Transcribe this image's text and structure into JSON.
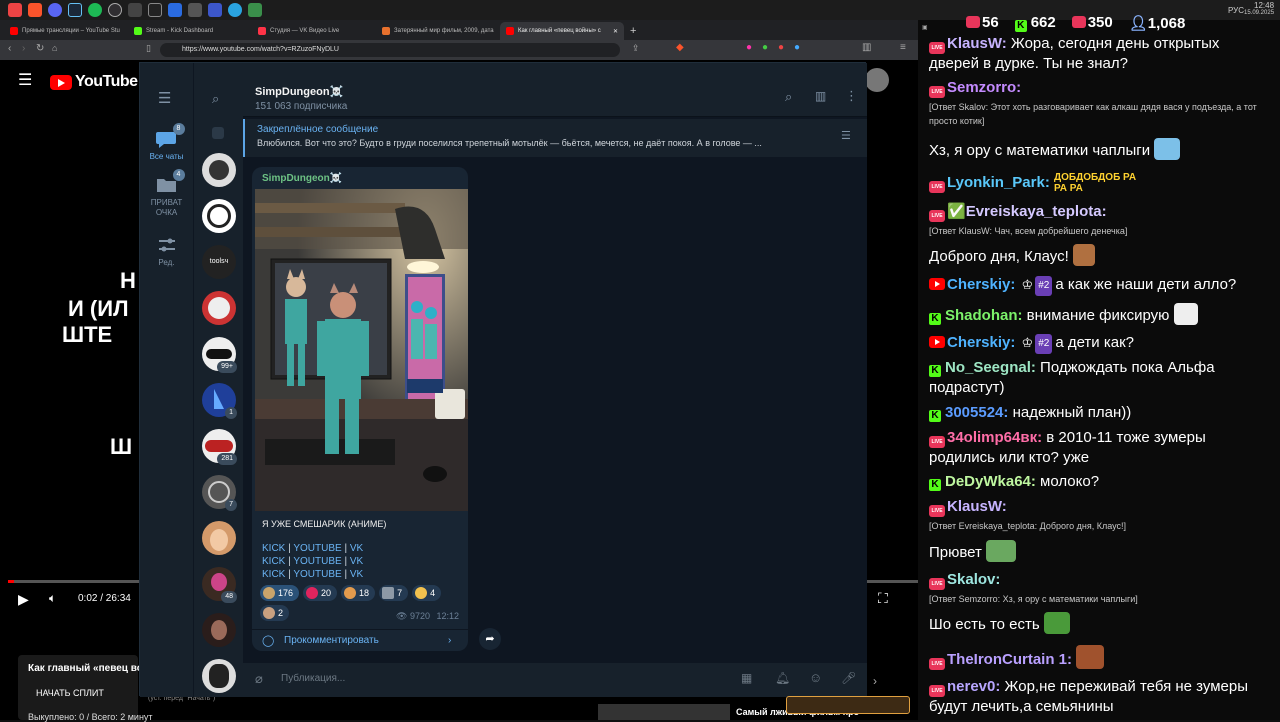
{
  "browser": {
    "tabs": [
      {
        "label": "Прямые трансляции – YouTube Stu",
        "color": "#ff0000"
      },
      {
        "label": "Stream - Kick Dashboard",
        "color": "#53fc18"
      },
      {
        "label": "Студия — VK Видео Live",
        "color": "#ff3347"
      },
      {
        "label": "Затерянный мир фильм, 2009, дата",
        "color": "#e8712d"
      },
      {
        "label": "Как главный «певец войны» с",
        "color": "#ff0000"
      }
    ],
    "url": "https://www.youtube.com/watch?v=RZuzoFNyDLU",
    "new_tab": "+"
  },
  "youtube": {
    "logo": "YouTube",
    "region": "LV",
    "hero_lines": [
      "Н",
      "И (ИЛ",
      "ШТЕ",
      "Ш"
    ],
    "time": "0:02 / 26:34",
    "video_title": "Как главный «певец вой",
    "split_button": "НАЧАТЬ СПЛИТ",
    "bought": "Выкуплено: 0 / Всего: 2 минут",
    "hint": "(уст. перед \"Начать\")",
    "right_title": "Самый лживый фильм про"
  },
  "telegram": {
    "rail": [
      {
        "label": "Все чаты",
        "badge": "8"
      },
      {
        "label": "ПРИВАТ ОЧКА",
        "badge": "4"
      },
      {
        "label": "Ред.",
        "badge": ""
      }
    ],
    "chat_badges": [
      "99+",
      "1",
      "281",
      "7",
      "48"
    ],
    "tools_avatar": "toolsч",
    "channel_name": "SimpDungeon☠️",
    "subscribers": "151 063 подписчика",
    "pinned_title": "Закреплённое сообщение",
    "pinned_text": "Влюбился.   Вот что это? Будто в груди поселился трепетный мотылёк — бьётся, мечется, не даёт покоя. А в голове — ...",
    "post": {
      "author": "SimpDungeon☠️",
      "caption": "Я УЖЕ СМЕШАРИК (АНИМЕ)",
      "links": [
        "KICK",
        "YOUTUBE",
        "VK"
      ],
      "separator": "|",
      "reactions": [
        {
          "count": "176",
          "color": "#c9a46b"
        },
        {
          "count": "20",
          "color": "#e0245e"
        },
        {
          "count": "18",
          "color": "#e39b4d"
        },
        {
          "count": "7",
          "color": "#8d99a6"
        },
        {
          "count": "4",
          "color": "#f2c14e"
        },
        {
          "count": "2",
          "color": "#c8a080"
        }
      ],
      "views": "9720",
      "time": "12:12",
      "comment": "Прокомментировать"
    },
    "composer_placeholder": "Публикация..."
  },
  "chat": {
    "stats": [
      {
        "icon": "vk-live-icon",
        "value": "56"
      },
      {
        "icon": "kick-icon",
        "value": "662"
      },
      {
        "icon": "vk-live-icon",
        "value": "350"
      },
      {
        "icon": "viewer-icon",
        "value": "1,068"
      }
    ],
    "messages": [
      {
        "platform": "live",
        "nick": "KlausW:",
        "color": "#c7b4ff",
        "text": "Жора, сегодня день открытых дверей в дурке. Ты не знал?"
      },
      {
        "platform": "live",
        "nick": "Semzorro:",
        "color": "#c48bff",
        "text": "",
        "reply": "[Ответ Skalov: Этот хоть разговаривает как алкаш дядя вася у подъезда, а тот просто котик]"
      },
      {
        "platform": "none",
        "nick": "",
        "color": "#fff",
        "text": "Хз, я ору с математики чаплыги"
      },
      {
        "platform": "live",
        "nick": "Lyonkin_Park:",
        "color": "#5ac8fa",
        "text": "",
        "emote_text": "ДОБДОБДОБ РА РА РА"
      },
      {
        "platform": "live",
        "nick": "Evreiskaya_teplota:",
        "color": "#d5c9ff",
        "text": "",
        "reply": "[Ответ KlausW: Чач, всем добрейшего денечка]"
      },
      {
        "platform": "none",
        "nick": "",
        "color": "#fff",
        "text": "Доброго дня, Клаус!"
      },
      {
        "platform": "yt",
        "nick": "Cherskiy:",
        "color": "#4fb3ff",
        "text": "а как же наши дети алло?",
        "rank": "#2"
      },
      {
        "platform": "kick",
        "nick": "Shadohan:",
        "color": "#7cf26a",
        "text": "внимание фиксирую"
      },
      {
        "platform": "yt",
        "nick": "Cherskiy:",
        "color": "#4fb3ff",
        "text": "а дети как?",
        "rank": "#2"
      },
      {
        "platform": "kick",
        "nick": "No_Seegnal:",
        "color": "#9ee6c4",
        "text": "Поджождать пока Альфа подрастут)"
      },
      {
        "platform": "kick",
        "nick": "3005524:",
        "color": "#5b9cff",
        "text": "надежный план))"
      },
      {
        "platform": "live",
        "nick": "34olimp64вк:",
        "color": "#ff6ea8",
        "text": "в 2010-11 тоже зумеры родились или кто? уже"
      },
      {
        "platform": "kick",
        "nick": "DeDyWka64:",
        "color": "#bff7a0",
        "text": "молоко?"
      },
      {
        "platform": "live",
        "nick": "KlausW:",
        "color": "#c7b4ff",
        "text": "",
        "reply": "[Ответ Evreiskaya_teplota: Доброго дня, Клаус!]"
      },
      {
        "platform": "none",
        "nick": "",
        "color": "#fff",
        "text": "Прювет"
      },
      {
        "platform": "live",
        "nick": "Skalov:",
        "color": "#9ee6e0",
        "text": "",
        "reply": "[Ответ Semzorro: Хз, я ору с математики чаплыги]"
      },
      {
        "platform": "none",
        "nick": "",
        "color": "#fff",
        "text": "Шо есть то есть"
      },
      {
        "platform": "live",
        "nick": "TheIronCurtain 1:",
        "color": "#b9a0ff",
        "text": ""
      },
      {
        "platform": "live",
        "nick": "nerev0:",
        "color": "#b8a6ff",
        "text": "Жор,не переживай тебя не зумеры будут лечить,а семьянины"
      }
    ]
  },
  "system": {
    "time": "12:48",
    "date": "15.09.2025",
    "lang": "РУС"
  },
  "colors": {
    "accent": "#6ab3f3",
    "tg_bg": "#0e1621",
    "tg_panel": "#17212b"
  }
}
